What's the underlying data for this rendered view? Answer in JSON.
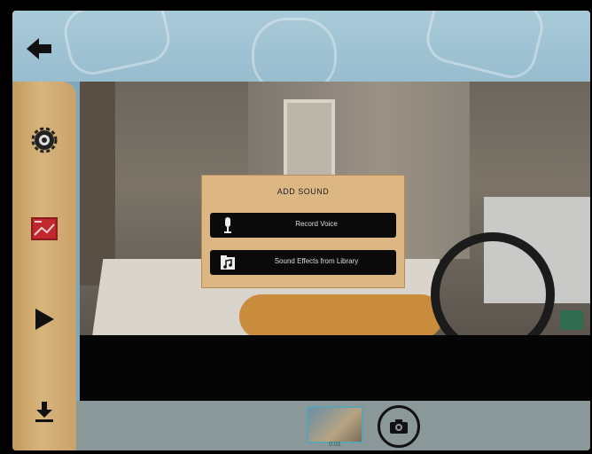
{
  "dialog": {
    "title": "ADD SOUND",
    "options": [
      {
        "label": "Record Voice",
        "icon": "microphone-icon"
      },
      {
        "label": "Sound Effects from Library",
        "icon": "music-note-icon"
      }
    ]
  },
  "sidebar": {
    "items": [
      {
        "name": "settings",
        "icon": "gear-icon"
      },
      {
        "name": "background",
        "icon": "picture-icon"
      },
      {
        "name": "play",
        "icon": "play-icon"
      },
      {
        "name": "export",
        "icon": "download-icon"
      }
    ]
  },
  "bottombar": {
    "thumbnail_label": "0:01"
  },
  "colors": {
    "accent_blue": "#a9cad8",
    "wood": "#d7b57d",
    "dialog_bg": "#dcb784"
  }
}
